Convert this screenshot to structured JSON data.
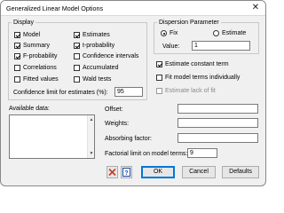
{
  "window": {
    "title": "Generalized Linear Model Options",
    "close_glyph": "✕"
  },
  "display": {
    "legend": "Display",
    "options": [
      {
        "label": "Model",
        "checked": true
      },
      {
        "label": "Estimates",
        "checked": true
      },
      {
        "label": "Summary",
        "checked": true
      },
      {
        "label": "t-probability",
        "checked": true
      },
      {
        "label": "F-probability",
        "checked": true
      },
      {
        "label": "Confidence intervals",
        "checked": false
      },
      {
        "label": "Correlations",
        "checked": false
      },
      {
        "label": "Accumulated",
        "checked": false
      },
      {
        "label": "Fitted values",
        "checked": false
      },
      {
        "label": "Wald tests",
        "checked": false
      }
    ],
    "confidence_label": "Confidence limit for estimates (%):",
    "confidence_value": "95"
  },
  "dispersion": {
    "legend": "Dispersion Parameter",
    "fix_label": "Fix",
    "estimate_label": "Estimate",
    "selected": "Fix",
    "value_label": "Value:",
    "value": "1"
  },
  "model_options": {
    "estimate_constant_label": "Estimate constant term",
    "estimate_constant_checked": true,
    "fit_individually_label": "Fit model terms individually",
    "fit_individually_checked": false,
    "estimate_lack_label": "Estimate lack of fit",
    "estimate_lack_checked": false,
    "estimate_lack_enabled": false
  },
  "available_data": {
    "label": "Available data:"
  },
  "fields": {
    "offset_label": "Offset:",
    "offset_value": "",
    "weights_label": "Weights:",
    "weights_value": "",
    "absorbing_label": "Absorbing factor:",
    "absorbing_value": "",
    "factorial_label": "Factorial limit on model terms:",
    "factorial_value": "9"
  },
  "buttons": {
    "ok": "OK",
    "cancel": "Cancel",
    "defaults": "Defaults"
  },
  "icons": {
    "clear": "clear-icon",
    "help": "help-icon",
    "clear_color": "#c0392b",
    "help_color": "#1f4fa3"
  }
}
